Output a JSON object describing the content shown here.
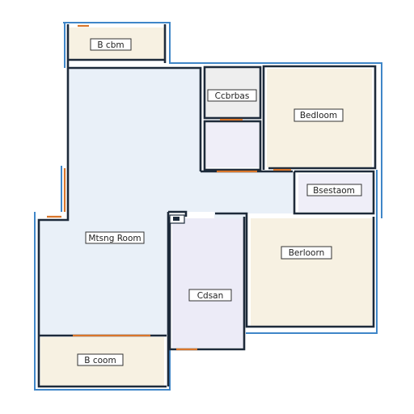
{
  "labels": {
    "top_small_room": "B cbm",
    "utility": "Ccbrbas",
    "bedroom_upper_right": "Bedloom",
    "bath_right": "Bsestaom",
    "living_room": "Mtsng Room",
    "bedroom_lower_right": "Berloorn",
    "closet": "Cdsan",
    "bottom_left_room": "B coom"
  },
  "colors": {
    "wall_dark": "#1d2a3a",
    "wall_blue": "#3f86c8",
    "door_orange": "#d9762b",
    "living_fill": "#e9f0f8",
    "beige_fill": "#f7f1e2",
    "bath_fill": "#efeef8",
    "closet_fill": "#ecebf7"
  }
}
